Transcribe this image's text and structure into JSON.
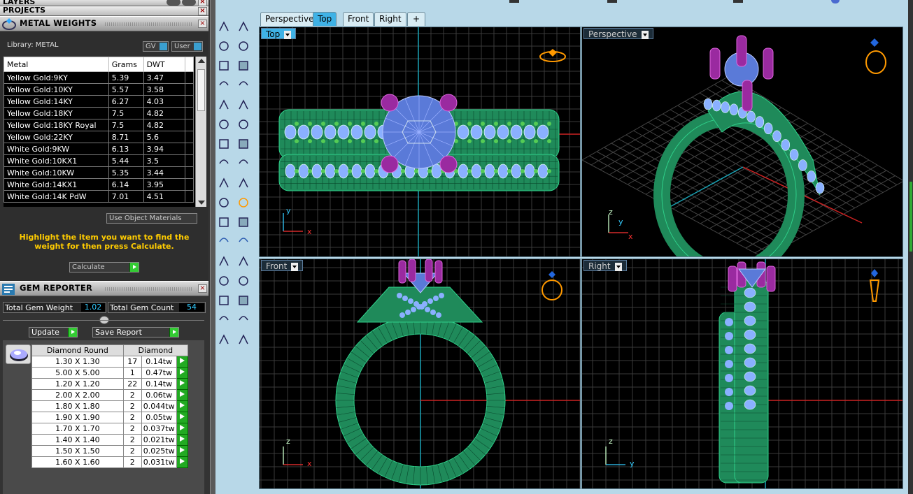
{
  "panels": {
    "layers": {
      "title": "LAYERS"
    },
    "projects": {
      "title": "PROJECTS"
    },
    "metal_weights": {
      "title": "METAL WEIGHTS",
      "library_label": "Library: METAL",
      "gv_label": "GV",
      "user_label": "User",
      "columns": [
        "Metal",
        "Grams",
        "DWT"
      ],
      "rows": [
        {
          "metal": "Yellow Gold:9KY",
          "grams": "5.39",
          "dwt": "3.47"
        },
        {
          "metal": "Yellow Gold:10KY",
          "grams": "5.57",
          "dwt": "3.58"
        },
        {
          "metal": "Yellow Gold:14KY",
          "grams": "6.27",
          "dwt": "4.03"
        },
        {
          "metal": "Yellow Gold:18KY",
          "grams": "7.5",
          "dwt": "4.82"
        },
        {
          "metal": "Yellow Gold:18KY Royal",
          "grams": "7.5",
          "dwt": "4.82"
        },
        {
          "metal": "Yellow Gold:22KY",
          "grams": "8.71",
          "dwt": "5.6"
        },
        {
          "metal": "White Gold:9KW",
          "grams": "6.13",
          "dwt": "3.94"
        },
        {
          "metal": "White Gold:10KX1",
          "grams": "5.44",
          "dwt": "3.5"
        },
        {
          "metal": "White Gold:10KW",
          "grams": "5.35",
          "dwt": "3.44"
        },
        {
          "metal": "White Gold:14KX1",
          "grams": "6.14",
          "dwt": "3.95"
        },
        {
          "metal": "White Gold:14K PdW",
          "grams": "7.01",
          "dwt": "4.51"
        }
      ],
      "use_object_materials": "Use Object Materials",
      "instruction": "Highlight the item you want to find the weight for then press Calculate.",
      "calculate": "Calculate"
    },
    "gem_reporter": {
      "title": "GEM REPORTER",
      "total_gem_weight_label": "Total Gem Weight",
      "total_gem_weight": "1.02",
      "total_gem_count_label": "Total Gem Count",
      "total_gem_count": "54",
      "update": "Update",
      "save_report": "Save Report",
      "col_shape": "Diamond Round",
      "col_type": "Diamond",
      "rows": [
        {
          "size": "1.30 X 1.30",
          "count": "17",
          "weight": "0.14tw"
        },
        {
          "size": "5.00 X 5.00",
          "count": "1",
          "weight": "0.47tw"
        },
        {
          "size": "1.20 X 1.20",
          "count": "22",
          "weight": "0.14tw"
        },
        {
          "size": "2.00 X 2.00",
          "count": "2",
          "weight": "0.06tw"
        },
        {
          "size": "1.80 X 1.80",
          "count": "2",
          "weight": "0.044tw"
        },
        {
          "size": "1.90 X 1.90",
          "count": "2",
          "weight": "0.05tw"
        },
        {
          "size": "1.70 X 1.70",
          "count": "2",
          "weight": "0.037tw"
        },
        {
          "size": "1.40 X 1.40",
          "count": "2",
          "weight": "0.021tw"
        },
        {
          "size": "1.50 X 1.50",
          "count": "2",
          "weight": "0.025tw"
        },
        {
          "size": "1.60 X 1.60",
          "count": "2",
          "weight": "0.031tw"
        }
      ]
    }
  },
  "viewport_tabs": [
    "Perspective",
    "Top",
    "Front",
    "Right",
    "+"
  ],
  "active_tab": "Top",
  "viewports": {
    "top": {
      "label": "Top",
      "axis1": "y",
      "axis2": "x"
    },
    "perspective": {
      "label": "Perspective",
      "axis1": "z",
      "axis2": "y",
      "axis3": "x"
    },
    "front": {
      "label": "Front",
      "axis1": "z",
      "axis2": "x"
    },
    "right": {
      "label": "Right",
      "axis1": "z",
      "axis2": "y"
    }
  },
  "colors": {
    "accent": "#3fb2e6",
    "metal": "#1f8a5a",
    "gems": "#8ab0ff",
    "prongs": "#9a2aa0",
    "warning_text": "#ffcc00"
  }
}
